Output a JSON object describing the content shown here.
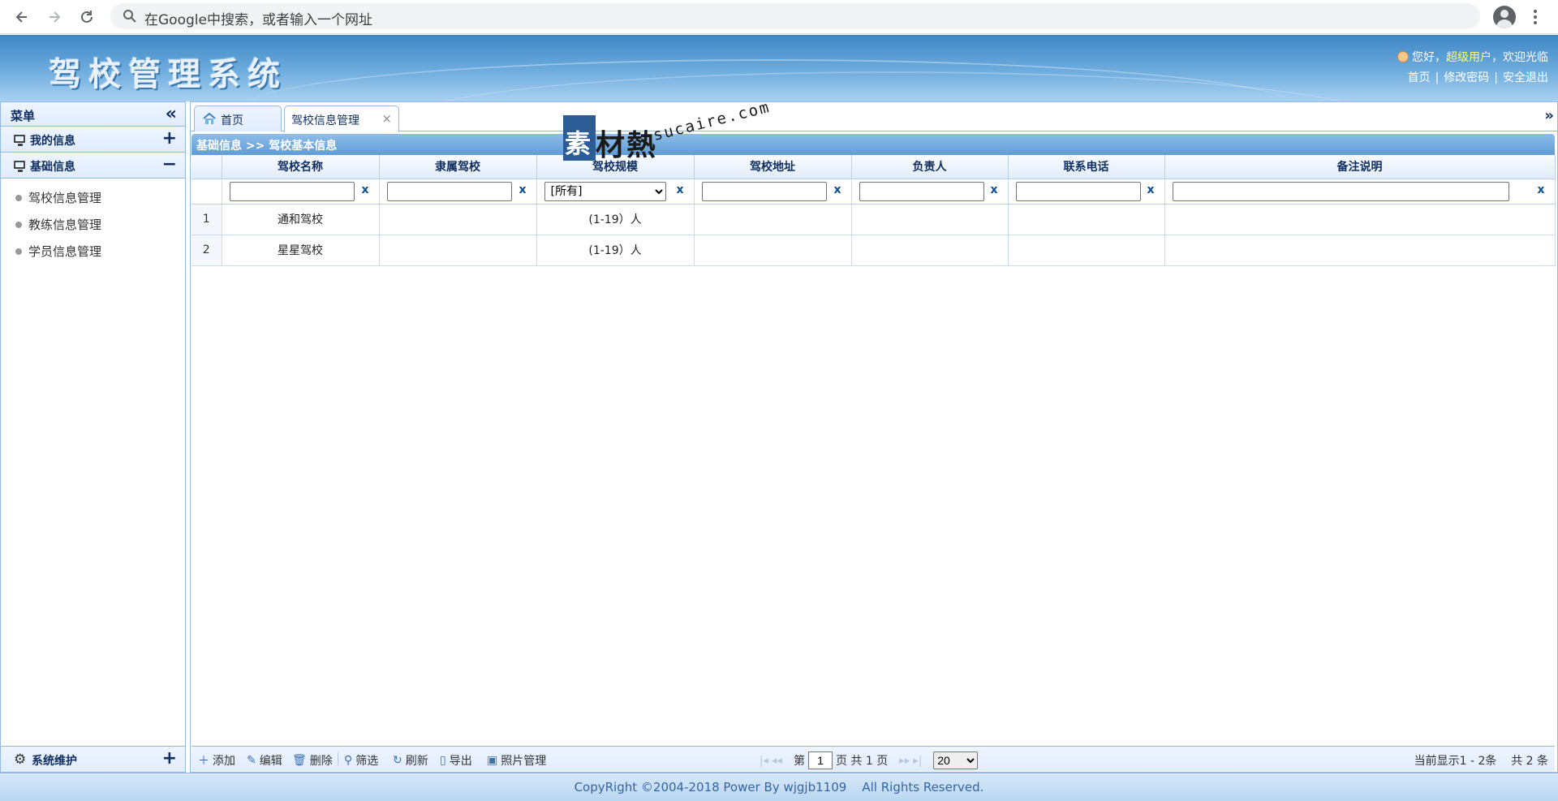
{
  "browser": {
    "omnibox_placeholder": "在Google中搜索，或者输入一个网址"
  },
  "header": {
    "title": "驾校管理系统",
    "greeting_prefix": "您好，",
    "user_name": "超级用户",
    "greeting_suffix": "，欢迎光临",
    "links": [
      "首页",
      "修改密码",
      "安全退出"
    ]
  },
  "sidebar": {
    "title": "菜单",
    "groups": [
      {
        "label": "我的信息",
        "toggle": "+"
      },
      {
        "label": "基础信息",
        "toggle": "−"
      }
    ],
    "items": [
      "驾校信息管理",
      "教练信息管理",
      "学员信息管理"
    ],
    "footer": {
      "label": "系统维护",
      "toggle": "+"
    }
  },
  "tabs": [
    {
      "label": "首页"
    },
    {
      "label": "驾校信息管理",
      "close": "×"
    }
  ],
  "panel": {
    "breadcrumb": "基础信息 >> 驾校基本信息"
  },
  "grid": {
    "columns": [
      "驾校名称",
      "隶属驾校",
      "驾校规模",
      "驾校地址",
      "负责人",
      "联系电话",
      "备注说明"
    ],
    "filter_clear": "x",
    "scale_filter_value": "[所有]",
    "rows": [
      {
        "num": "1",
        "name": "通和驾校",
        "parent": "",
        "scale": "(1-19）人",
        "address": "",
        "manager": "",
        "phone": "",
        "note": ""
      },
      {
        "num": "2",
        "name": "星星驾校",
        "parent": "",
        "scale": "(1-19）人",
        "address": "",
        "manager": "",
        "phone": "",
        "note": ""
      }
    ]
  },
  "toolbar": {
    "add": "添加",
    "edit": "编辑",
    "delete": "删除",
    "filter": "筛选",
    "refresh": "刷新",
    "export": "导出",
    "photos": "照片管理"
  },
  "pager": {
    "page_prefix": "第",
    "page_value": "1",
    "page_suffix": "页 共 1 页",
    "page_size": "20",
    "showing": "当前显示1 - 2条",
    "total": "共 2 条"
  },
  "footer": {
    "copyright": "CopyRight ©2004-2018 Power By wjgjb1109    All Rights Reserved."
  },
  "watermark": {
    "glyph": "素",
    "cn": "材熱",
    "en": "sucaire.com"
  },
  "colors": {
    "header_blue": "#5f9cd6",
    "border_blue": "#95b8e7",
    "user_highlight": "#ffff66"
  }
}
